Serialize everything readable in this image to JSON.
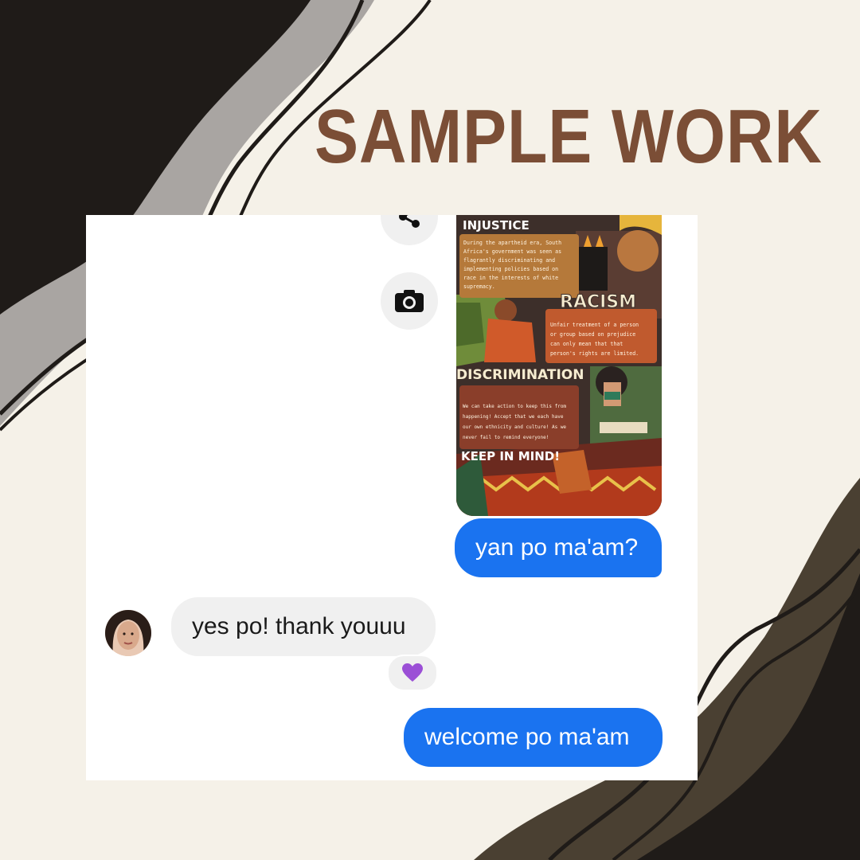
{
  "title": "SAMPLE WORK",
  "colors": {
    "background": "#f5f1e8",
    "title": "#7b4e36",
    "wave_dark": "#1f1b18",
    "wave_gray": "#a9a5a2",
    "wave_olive": "#4a4032",
    "outgoing_bubble": "#1a73f0",
    "incoming_bubble": "#f0f0f0"
  },
  "chat": {
    "actions": [
      {
        "icon": "share-icon"
      },
      {
        "icon": "camera-icon"
      }
    ],
    "poster": {
      "headings": [
        "INJUSTICE",
        "RACISM",
        "DISCRIMINATION",
        "KEEP IN MIND!"
      ],
      "paragraphs": [
        [
          "During the apartheid era, South",
          "Africa's government was seen as",
          "flagrantly discriminating and",
          "implementing policies based on",
          "race in the interests of white",
          "supremacy."
        ],
        [
          "Unfair treatment of a person",
          "or group based on prejudice",
          "can only mean that that",
          "person's rights are limited."
        ],
        [
          "We can take action to keep this from",
          "happening! Accept that we each have",
          "our own ethnicity and culture! As we",
          "never fail to remind everyone!"
        ]
      ]
    },
    "messages": [
      {
        "text": "yan po ma'am?",
        "direction": "outgoing"
      },
      {
        "text": "yes po! thank youuu",
        "direction": "incoming",
        "reaction": "purple-heart"
      },
      {
        "text": "welcome po ma'am",
        "direction": "outgoing"
      }
    ]
  }
}
